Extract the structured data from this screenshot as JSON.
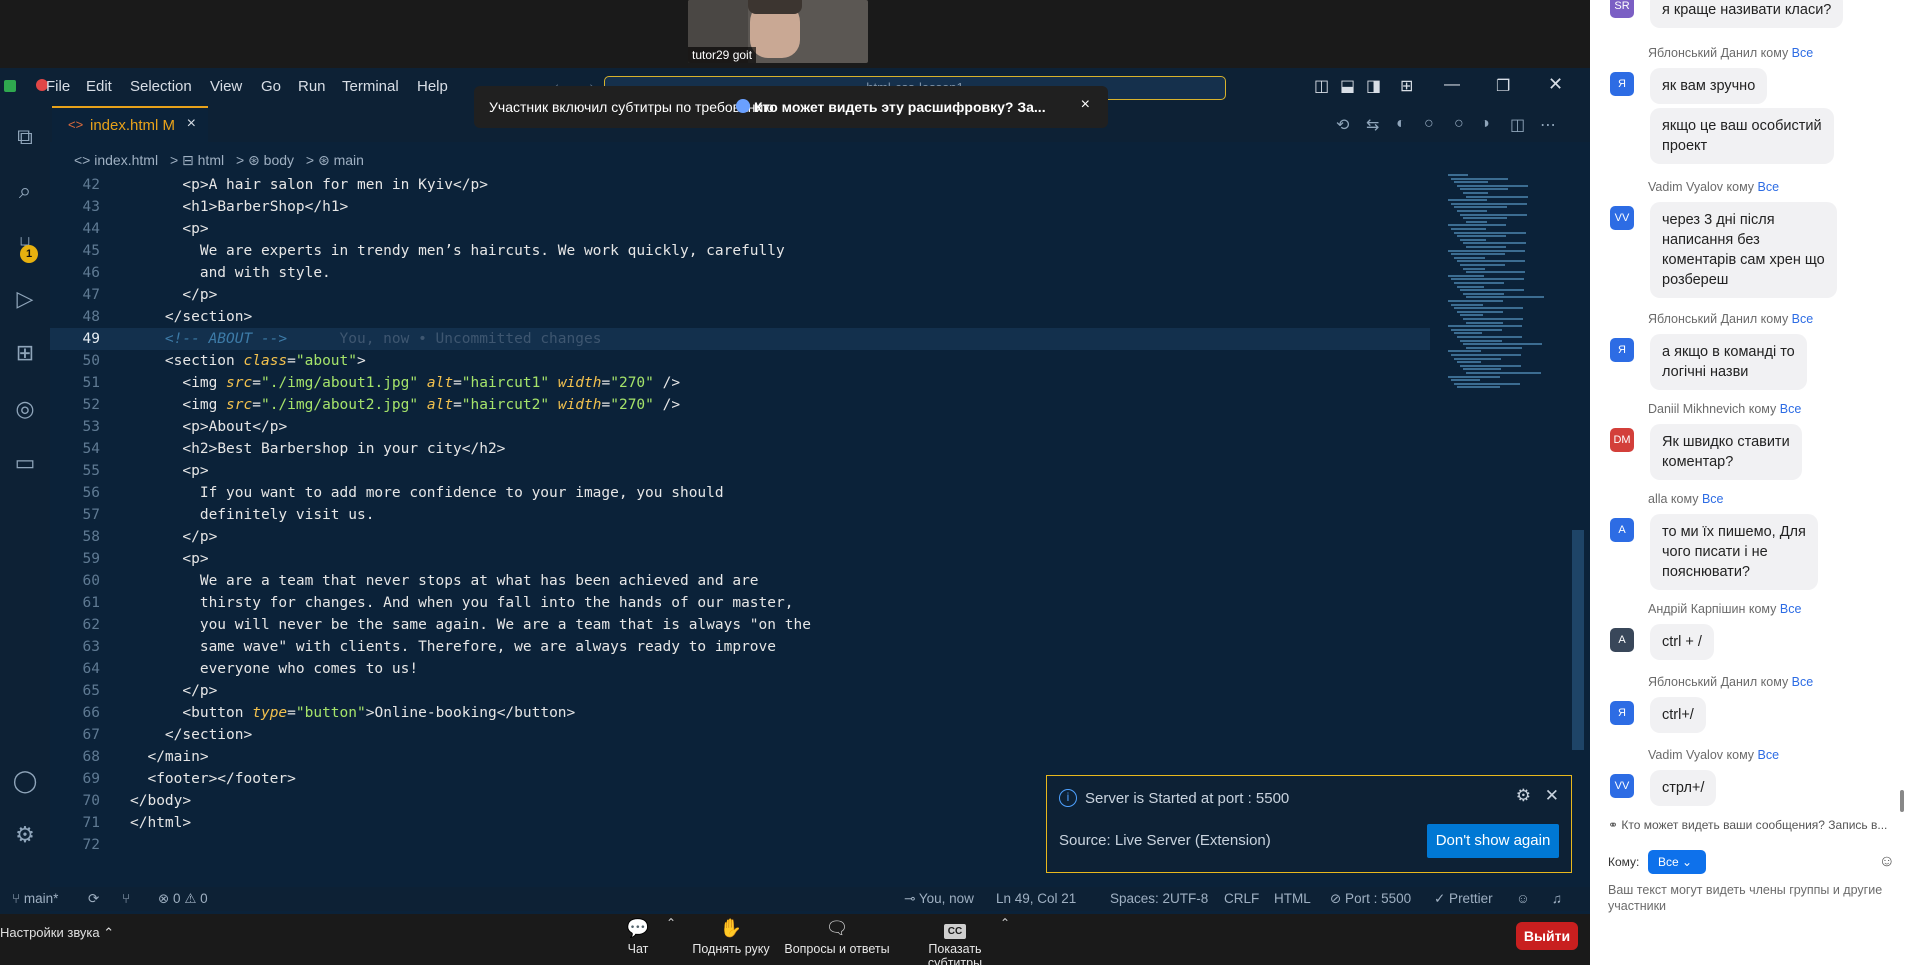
{
  "zoom": {
    "participant_name": "tutor29 goit",
    "toolbar": {
      "chat": "Чат",
      "raise_hand": "Поднять руку",
      "qa": "Вопросы и ответы",
      "captions": "Показать субтитры",
      "captions_icon_text": "CC",
      "leave": "Выйти",
      "sound_settings": "Настройки звука"
    },
    "subtitle_toast": {
      "text": "Участник включил субтитры по требованию",
      "link": "Кто может видеть эту расшифровку? За...",
      "close": "×"
    }
  },
  "vscode": {
    "menu": [
      "File",
      "Edit",
      "Selection",
      "View",
      "Go",
      "Run",
      "Terminal",
      "Help"
    ],
    "command_center": "html-css-lesson1",
    "tab": {
      "icon": "<>",
      "label": "index.html M",
      "close": "×"
    },
    "breadcrumb": [
      "<> index.html",
      "> ⊟ html",
      "> ⊛ body",
      "> ⊛ main"
    ],
    "lines": [
      {
        "n": "42",
        "html": "      <span class='tag'>&lt;p&gt;</span>A hair salon for men in Kyiv<span class='tag'>&lt;/p&gt;</span>"
      },
      {
        "n": "43",
        "html": "      <span class='tag'>&lt;h1&gt;</span>BarberShop<span class='tag'>&lt;/h1&gt;</span>"
      },
      {
        "n": "44",
        "html": "      <span class='tag'>&lt;p&gt;</span>"
      },
      {
        "n": "45",
        "html": "        We are experts in trendy men’s haircuts. We work quickly, carefully"
      },
      {
        "n": "46",
        "html": "        and with style."
      },
      {
        "n": "47",
        "html": "      <span class='tag'>&lt;/p&gt;</span>"
      },
      {
        "n": "48",
        "html": "    <span class='tag'>&lt;/section&gt;</span>"
      },
      {
        "n": "49",
        "html": "    <span class='cmt'>&lt;!-- ABOUT --&gt;</span>      <span class='ghost'>You, now • Uncommitted changes</span>",
        "current": true
      },
      {
        "n": "50",
        "html": "    <span class='tag'>&lt;section</span> <span class='attr'>class</span>=<span class='str'>\"about\"</span><span class='tag'>&gt;</span>"
      },
      {
        "n": "51",
        "html": "      <span class='tag'>&lt;img</span> <span class='attr'>src</span>=<span class='str'>\"./img/about1.jpg\"</span> <span class='attr'>alt</span>=<span class='str'>\"haircut1\"</span> <span class='attr'>width</span>=<span class='str'>\"270\"</span> <span class='tag'>/&gt;</span>"
      },
      {
        "n": "52",
        "html": "      <span class='tag'>&lt;img</span> <span class='attr'>src</span>=<span class='str'>\"./img/about2.jpg\"</span> <span class='attr'>alt</span>=<span class='str'>\"haircut2\"</span> <span class='attr'>width</span>=<span class='str'>\"270\"</span> <span class='tag'>/&gt;</span>"
      },
      {
        "n": "53",
        "html": "      <span class='tag'>&lt;p&gt;</span>About<span class='tag'>&lt;/p&gt;</span>"
      },
      {
        "n": "54",
        "html": "      <span class='tag'>&lt;h2&gt;</span>Best Barbershop in your city<span class='tag'>&lt;/h2&gt;</span>"
      },
      {
        "n": "55",
        "html": "      <span class='tag'>&lt;p&gt;</span>"
      },
      {
        "n": "56",
        "html": "        If you want to add more confidence to your image, you should"
      },
      {
        "n": "57",
        "html": "        definitely visit us."
      },
      {
        "n": "58",
        "html": "      <span class='tag'>&lt;/p&gt;</span>"
      },
      {
        "n": "59",
        "html": "      <span class='tag'>&lt;p&gt;</span>"
      },
      {
        "n": "60",
        "html": "        We are a team that never stops at what has been achieved and are"
      },
      {
        "n": "61",
        "html": "        thirsty for changes. And when you fall into the hands of our master,"
      },
      {
        "n": "62",
        "html": "        you will never be the same again. We are a team that is always \"on the"
      },
      {
        "n": "63",
        "html": "        same wave\" with clients. Therefore, we are always ready to improve"
      },
      {
        "n": "64",
        "html": "        everyone who comes to us!"
      },
      {
        "n": "65",
        "html": "      <span class='tag'>&lt;/p&gt;</span>"
      },
      {
        "n": "66",
        "html": "      <span class='tag'>&lt;button</span> <span class='attr'>type</span>=<span class='str'>\"button\"</span><span class='tag'>&gt;</span>Online-booking<span class='tag'>&lt;/button&gt;</span>"
      },
      {
        "n": "67",
        "html": "    <span class='tag'>&lt;/section&gt;</span>"
      },
      {
        "n": "68",
        "html": "  <span class='tag'>&lt;/main&gt;</span>"
      },
      {
        "n": "69",
        "html": "  <span class='tag'>&lt;footer&gt;&lt;/footer&gt;</span>"
      },
      {
        "n": "70",
        "html": "<span class='tag'>&lt;/body&gt;</span>"
      },
      {
        "n": "71",
        "html": "<span class='tag'>&lt;/html&gt;</span>"
      },
      {
        "n": "72",
        "html": ""
      }
    ],
    "notification": {
      "message": "Server is Started at port : 5500",
      "source": "Source: Live Server (Extension)",
      "button": "Don't show again"
    },
    "status": {
      "branch": "main*",
      "problems": "⊗ 0 ⚠ 0",
      "blame": "You, now",
      "position": "Ln 49, Col 21",
      "spaces": "Spaces: 2",
      "encoding": "UTF-8",
      "eol": "CRLF",
      "language": "HTML",
      "port": "⊘ Port : 5500",
      "prettier": "✓ Prettier"
    },
    "scm_badge": "1"
  },
  "chat": {
    "first_message": "я краще називати класи?",
    "first_avatar": "SR",
    "messages": [
      {
        "sender": "Яблонський Данил",
        "to": "Все",
        "avatar": "Я",
        "avatar_color": "#2d6ce4",
        "texts": [
          "як вам зручно",
          "якщо це ваш особистий\nпроект"
        ]
      },
      {
        "sender": "Vadim Vyalov",
        "to": "Все",
        "avatar": "VV",
        "avatar_color": "#2d6ce4",
        "texts": [
          "через 3 дні після\nнаписання без\nкоментарів сам хрен що\nрозбереш"
        ]
      },
      {
        "sender": "Яблонський Данил",
        "to": "Все",
        "avatar": "Я",
        "avatar_color": "#2d6ce4",
        "texts": [
          "а якщо в команді то\nлогічні назви"
        ]
      },
      {
        "sender": "Daniil Mikhnevich",
        "to": "Все",
        "avatar": "DM",
        "avatar_color": "#d33f3a",
        "texts": [
          "Як швидко ставити\nкоментар?"
        ]
      },
      {
        "sender": "alla",
        "to": "Все",
        "avatar": "A",
        "avatar_color": "#2d6ce4",
        "texts": [
          "то ми їх пишемо, Для\nчого писати і не\nпояснювати?"
        ]
      },
      {
        "sender": "Андрій Карпішин",
        "to": "Все",
        "avatar": "A",
        "avatar_color": "#39475a",
        "texts": [
          "ctrl + /"
        ]
      },
      {
        "sender": "Яблонський Данил",
        "to": "Все",
        "avatar": "Я",
        "avatar_color": "#2d6ce4",
        "texts": [
          "ctrl+/"
        ]
      },
      {
        "sender": "Vadim Vyalov",
        "to": "Все",
        "avatar": "VV",
        "avatar_color": "#2d6ce4",
        "texts": [
          "стрл+/"
        ]
      }
    ],
    "to_word": "кому",
    "who_can_see": "Кто может видеть ваши сообщения? Запись в...",
    "to_label": "Кому:",
    "to_value": "Все",
    "placeholder": "Ваш текст могут видеть члены группы и другие участники"
  }
}
